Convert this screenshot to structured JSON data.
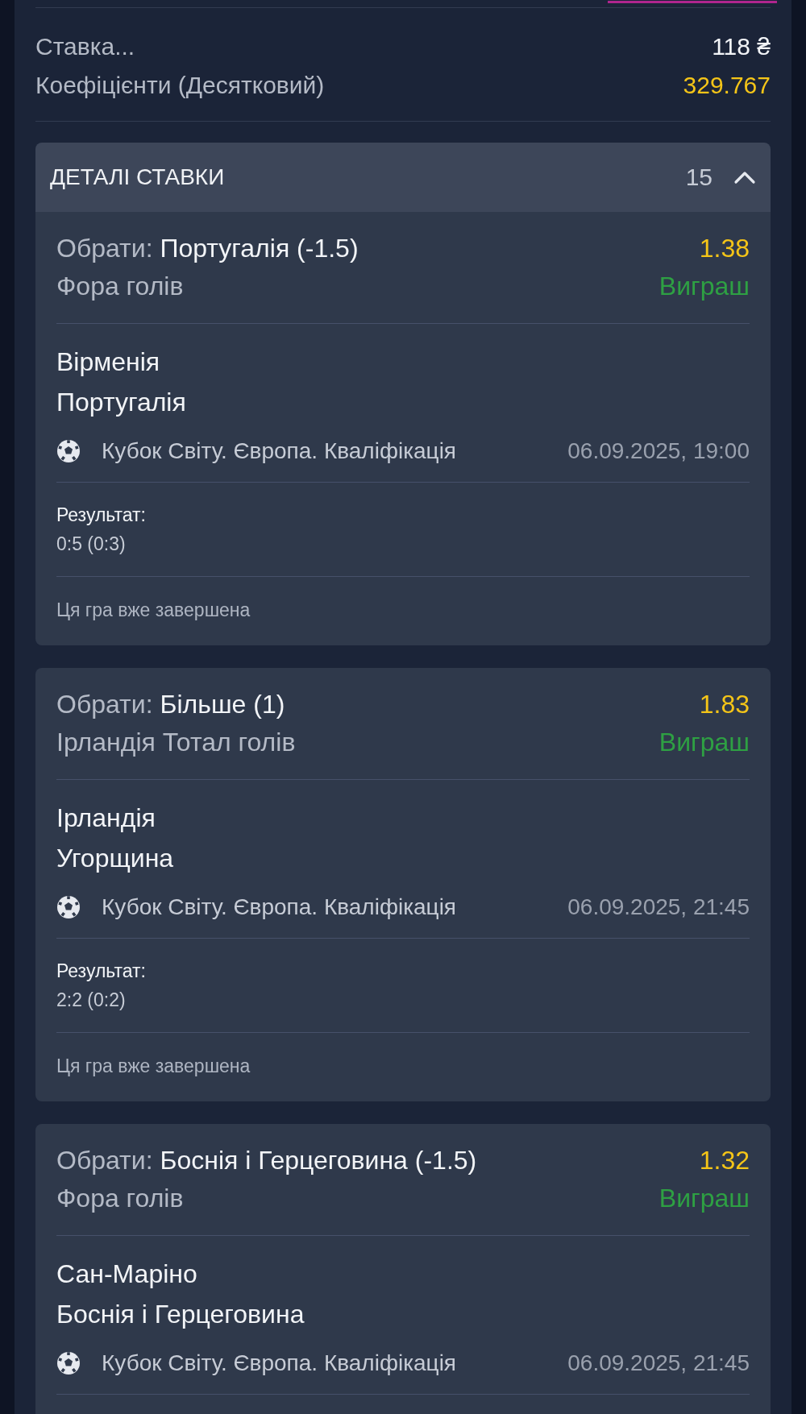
{
  "summary": {
    "stake_label": "Ставка...",
    "stake_value": "118 ₴",
    "odds_label": "Коефіцієнти (Десятковий)",
    "odds_value": "329.767"
  },
  "details": {
    "title": "ДЕТАЛІ СТАВКИ",
    "count": "15",
    "expanded": true,
    "bets": [
      {
        "select_label": "Обрати:",
        "selection": "Португалія (-1.5)",
        "odds": "1.38",
        "market": "Фора голів",
        "status": "Виграш",
        "kind": "win",
        "teams": [
          "Вірменія",
          "Португалія"
        ],
        "league": "Кубок Світу. Європа. Кваліфікація",
        "datetime": "06.09.2025, 19:00",
        "result_label": "Результат:",
        "result": "0:5 (0:3)",
        "note": "Ця гра вже завершена"
      },
      {
        "select_label": "Обрати:",
        "selection": "Більше (1)",
        "odds": "1.83",
        "market": "Ірландія Тотал голів",
        "status": "Виграш",
        "kind": "win",
        "teams": [
          "Ірландія",
          "Угорщина"
        ],
        "league": "Кубок Світу. Європа. Кваліфікація",
        "datetime": "06.09.2025, 21:45",
        "result_label": "Результат:",
        "result": "2:2 (0:2)",
        "note": "Ця гра вже завершена"
      },
      {
        "select_label": "Обрати:",
        "selection": "Боснія і Герцеговина (-1.5)",
        "odds": "1.32",
        "market": "Фора голів",
        "status": "Виграш",
        "kind": "win",
        "teams": [
          "Сан-Маріно",
          "Боснія і Герцеговина"
        ],
        "league": "Кубок Світу. Європа. Кваліфікація",
        "datetime": "06.09.2025, 21:45"
      }
    ]
  }
}
